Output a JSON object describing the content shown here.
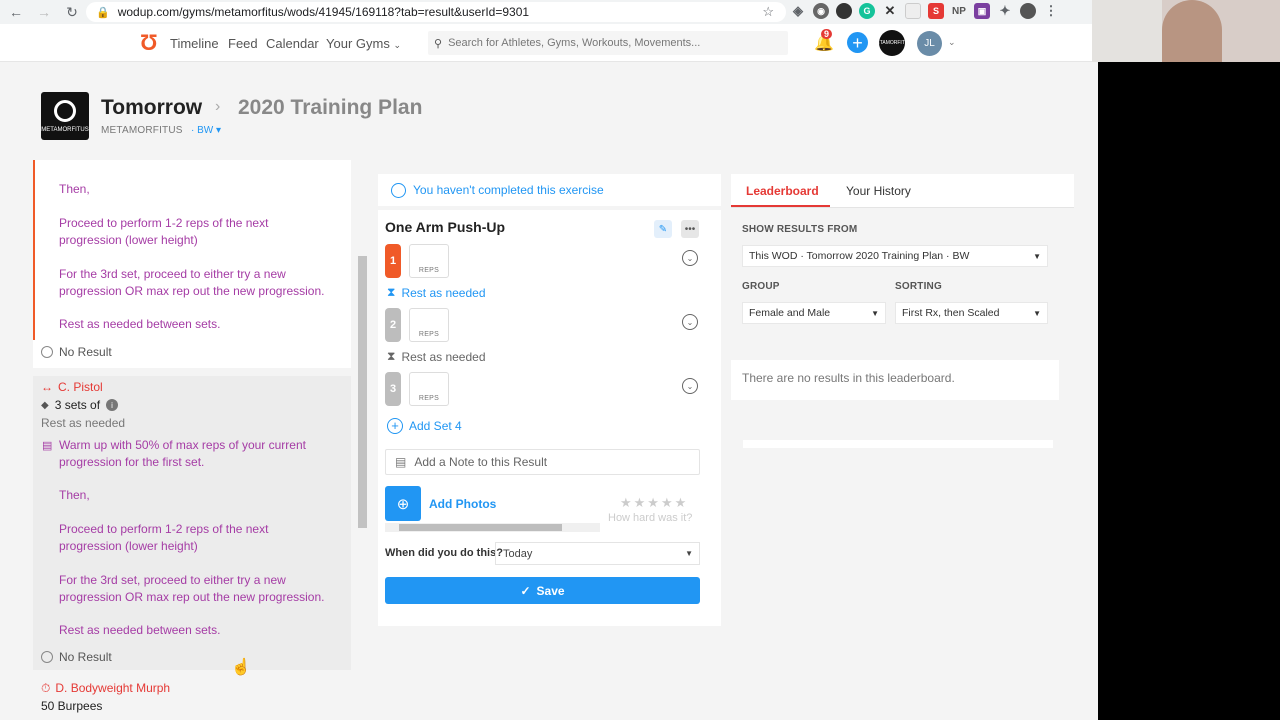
{
  "browser": {
    "url": "wodup.com/gyms/metamorfitus/wods/41945/169118?tab=result&userId=9301",
    "extensions": [
      "dropbox-icon",
      "extension-icon",
      "circle-icon",
      "grammarly-icon",
      "x-icon",
      "doc-icon",
      "s-icon",
      "np-icon",
      "purple-icon",
      "puzzle-icon",
      "avatar-icon"
    ],
    "ext_text": {
      "s": "S",
      "np": "NP"
    }
  },
  "app": {
    "nav": {
      "timeline": "Timeline",
      "feed": "Feed",
      "calendar": "Calendar",
      "your_gyms": "Your Gyms"
    },
    "search_placeholder": "Search for Athletes, Gyms, Workouts, Movements...",
    "notification_count": "9",
    "gym_avatar_text": "METAMORFITUS",
    "user_initials": "JL"
  },
  "wod": {
    "title": "Tomorrow",
    "program": "2020 Training Plan",
    "gym": "METAMORFITUS",
    "track": "BW"
  },
  "left": {
    "card1": {
      "lines": [
        "Then,",
        "Proceed to perform 1-2 reps of the next progression (lower height)",
        "For the 3rd set, proceed to either try a new progression OR max rep out the new progression.",
        "Rest as needed between sets."
      ],
      "result": "No Result"
    },
    "card2": {
      "label": "C. Pistol",
      "sets": "3 sets of",
      "rest": "Rest as needed",
      "lines": [
        "Warm up with 50% of max reps of your current progression for the first set.",
        "Then,",
        "Proceed to perform 1-2 reps of the next progression (lower height)",
        "For the 3rd set, proceed to either try a new progression OR max rep out the new progression.",
        "Rest as needed between sets."
      ],
      "result": "No Result"
    },
    "card3": {
      "label": "D. Bodyweight Murph",
      "first": "50 Burpees"
    }
  },
  "middle": {
    "status": "You haven't completed this exercise",
    "exercise": "One Arm Push-Up",
    "reps_label": "REPS",
    "rest1": "Rest as needed",
    "rest2": "Rest as needed",
    "sets": [
      "1",
      "2",
      "3"
    ],
    "add_set": "Add Set 4",
    "note": "Add a Note to this Result",
    "add_photos": "Add Photos",
    "how_hard": "How hard was it?",
    "when_label": "When did you do this?",
    "when_value": "Today",
    "save": "Save",
    "colors": {
      "active": "#f05a28",
      "inactive": "#bdbdbd"
    }
  },
  "right": {
    "tab_leaderboard": "Leaderboard",
    "tab_history": "Your History",
    "show_results_label": "SHOW RESULTS FROM",
    "show_results_value": "This WOD · Tomorrow 2020 Training Plan · BW",
    "group_label": "GROUP",
    "group_value": "Female and Male",
    "sorting_label": "SORTING",
    "sorting_value": "First Rx, then Scaled",
    "empty": "There are no results in this leaderboard."
  }
}
